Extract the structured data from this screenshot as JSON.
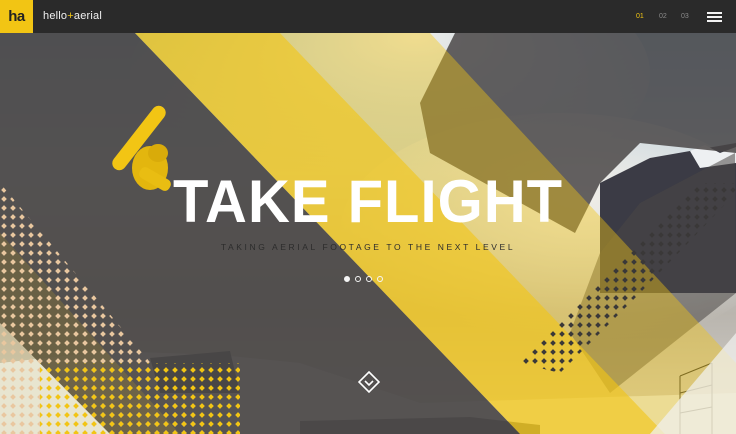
{
  "header": {
    "logo_text": "ha",
    "brand_part1": "hello",
    "brand_plus": "+",
    "brand_part2": "aerial",
    "pages": [
      {
        "num": "01",
        "active": true
      },
      {
        "num": "02",
        "active": false
      },
      {
        "num": "03",
        "active": false
      }
    ],
    "menu_icon": "hamburger-menu-icon"
  },
  "hero": {
    "headline": "TAKE FLIGHT",
    "tagline": "TAKING AERIAL FOOTAGE TO THE NEXT LEVEL",
    "slides": [
      {
        "active": true
      },
      {
        "active": false
      },
      {
        "active": false
      },
      {
        "active": false
      }
    ],
    "scroll_icon": "chevron-down-diamond-icon"
  },
  "colors": {
    "accent": "#f2c514",
    "topbar": "#2a2a2a",
    "stripe_dark": "#4a4746",
    "text_light": "#ffffff"
  }
}
